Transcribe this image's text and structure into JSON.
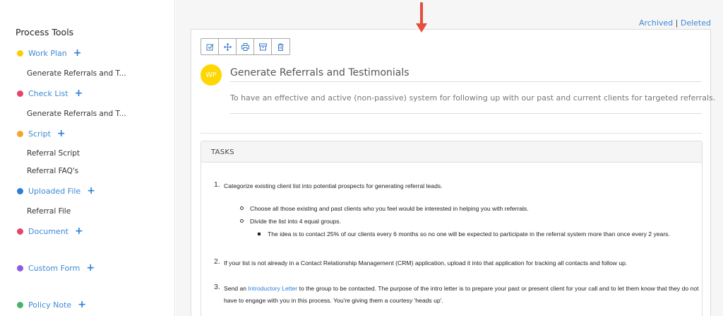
{
  "sidebar": {
    "title": "Process Tools",
    "tools": [
      {
        "label": "Work Plan",
        "color": "#ffcc00",
        "items": [
          "Generate Referrals and T..."
        ]
      },
      {
        "label": "Check List",
        "color": "#e8436a",
        "items": [
          "Generate Referrals and T..."
        ]
      },
      {
        "label": "Script",
        "color": "#f6a52a",
        "items": [
          "Referral Script",
          "Referral FAQ's"
        ]
      },
      {
        "label": "Uploaded File",
        "color": "#2b7fd9",
        "items": [
          "Referral File"
        ]
      },
      {
        "label": "Document",
        "color": "#e8436a",
        "items": []
      },
      {
        "label": "Custom Form",
        "color": "#8b5ce0",
        "items": []
      },
      {
        "label": "Policy Note",
        "color": "#48b36a",
        "items": []
      }
    ],
    "plus_symbol": "+"
  },
  "header_links": {
    "archived": "Archived",
    "separator": "|",
    "deleted": "Deleted"
  },
  "toolbar": {
    "icons": [
      "edit-icon",
      "move-icon",
      "print-icon",
      "archive-icon",
      "trash-icon"
    ]
  },
  "workplan": {
    "avatar": "WP",
    "title": "Generate Referrals and Testimonials",
    "description": "To have an effective and active (non-passive) system for following up with our past and current clients for targeted referrals."
  },
  "tasks": {
    "header": "TASKS",
    "items": [
      {
        "num": "1.",
        "text": "Categorize existing client list into potential prospects for generating referral leads.",
        "sub1": "Choose all those existing and past clients who you feel would be interested in helping you with referrals.",
        "sub2": "Divide the list into 4 equal groups.",
        "sub3": "The idea is to contact 25% of our clients every 6 months so no one will be expected to participate in the referral system more than once every 2 years."
      },
      {
        "num": "2.",
        "text": "If your list is not already in a Contact Relationship Management (CRM) application, upload it into that application for tracking all contacts and follow up."
      },
      {
        "num": "3.",
        "text_before": "Send an",
        "link": "Introductory Letter",
        "text_after": "to the group to be contacted. The purpose of the intro letter is to prepare your past or present client for your call and to let them know that they do not",
        "text_line2": "have to engage with you in this process. You're giving them a courtesy 'heads up'."
      }
    ]
  }
}
